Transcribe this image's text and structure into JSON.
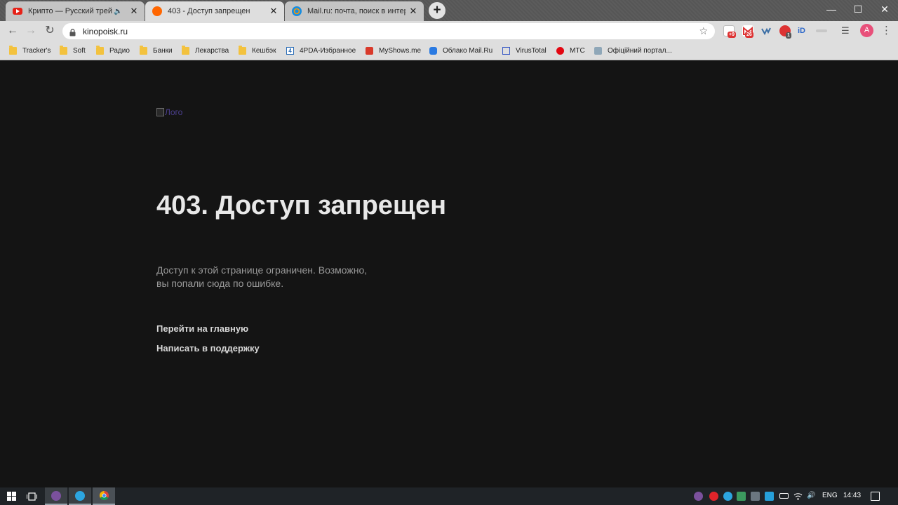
{
  "browser": {
    "tabs": [
      {
        "title": "Крипто — Русский трейлер",
        "favicon": "youtube-icon",
        "audio": true
      },
      {
        "title": "403 - Доступ запрещен",
        "favicon": "kinopoisk-icon",
        "active": true
      },
      {
        "title": "Mail.ru: почта, поиск в интерне’",
        "favicon": "mailru-icon"
      }
    ],
    "new_tab": "+",
    "window_controls": {
      "minimize": "—",
      "maximize": "☐",
      "close": "✕"
    }
  },
  "toolbar": {
    "url": "kinopoisk.ru",
    "extension_badges": {
      "ext1": "+9",
      "ext2": "26",
      "ext5": "1"
    },
    "avatar_letter": "A"
  },
  "bookmarks": [
    {
      "label": "Tracker's",
      "icon": "folder-icon"
    },
    {
      "label": "Soft",
      "icon": "folder-icon"
    },
    {
      "label": "Радио",
      "icon": "folder-icon"
    },
    {
      "label": "Банки",
      "icon": "folder-icon"
    },
    {
      "label": "Лекарства",
      "icon": "folder-icon"
    },
    {
      "label": "Кешбэк",
      "icon": "folder-icon"
    },
    {
      "label": "4PDA-Избранное",
      "icon": "4pda-icon"
    },
    {
      "label": "MyShows.me",
      "icon": "myshows-icon"
    },
    {
      "label": "Облако Mail.Ru",
      "icon": "cloud-mailru-icon"
    },
    {
      "label": "VirusTotal",
      "icon": "virustotal-icon"
    },
    {
      "label": "МТС",
      "icon": "mts-icon"
    },
    {
      "label": "Офіційний портал...",
      "icon": "portal-icon"
    }
  ],
  "page": {
    "logo_alt": "Лого",
    "heading": "403. Доступ запрещен",
    "description": "Доступ к этой странице ограничен. Возможно, вы попали сюда по ошибке.",
    "links": [
      "Перейти на главную",
      "Написать в поддержку"
    ]
  },
  "taskbar": {
    "language": "ENG",
    "time": "14:43"
  },
  "colors": {
    "page_bg": "#141414",
    "heading": "#e8e8e8",
    "description": "#9a9a9a",
    "link": "#d8d8d8"
  }
}
